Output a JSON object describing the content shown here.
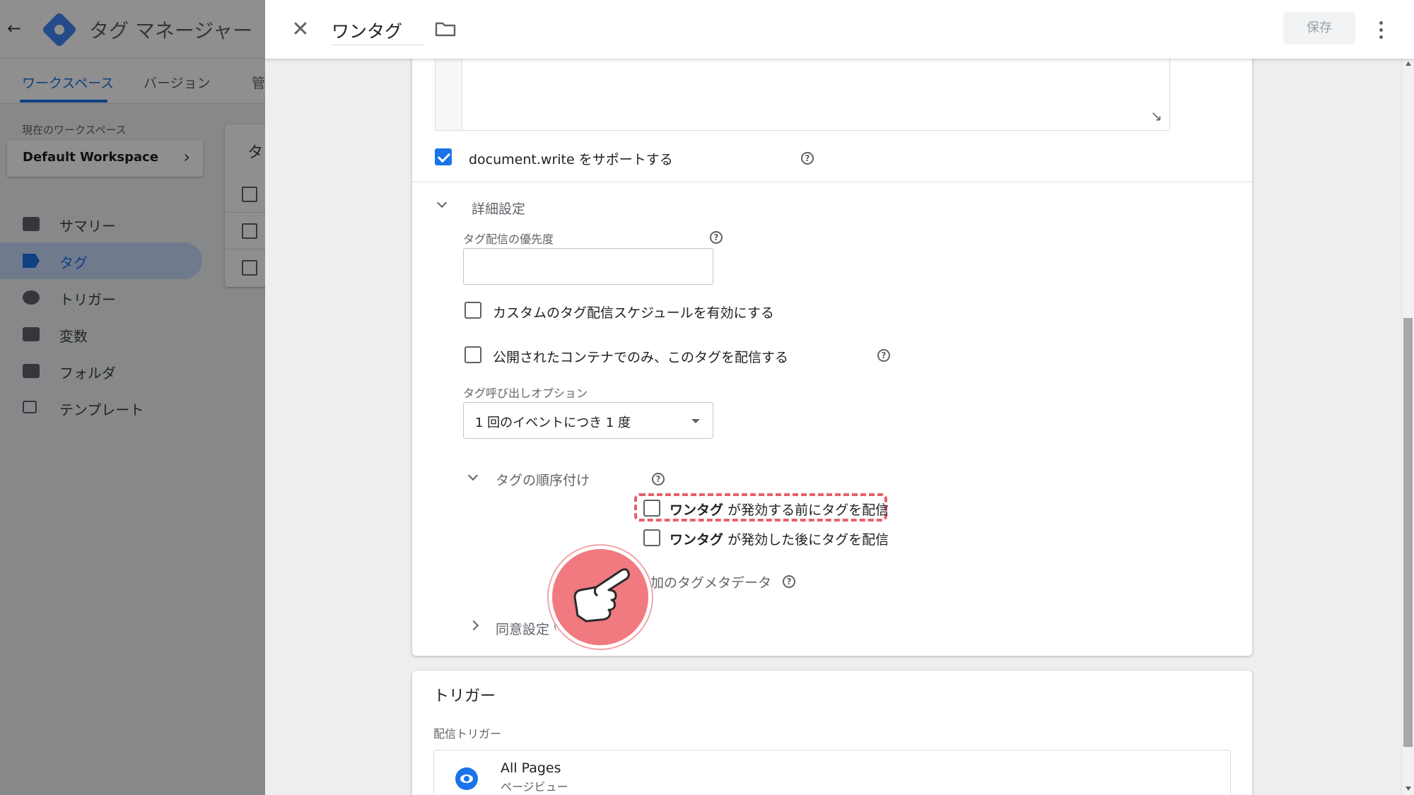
{
  "app": {
    "title": "タグ マネージャー",
    "tabs": [
      "ワークスペース",
      "バージョン",
      "管"
    ],
    "workspace_label": "現在のワークスペース",
    "workspace_name": "Default Workspace",
    "card_title": "タ",
    "nav": [
      {
        "label": "サマリー",
        "icon": "briefcase-icon"
      },
      {
        "label": "タグ",
        "icon": "tag-icon"
      },
      {
        "label": "トリガー",
        "icon": "trigger-icon"
      },
      {
        "label": "変数",
        "icon": "variables-icon"
      },
      {
        "label": "フォルダ",
        "icon": "folder-icon"
      },
      {
        "label": "テンプレート",
        "icon": "template-icon"
      }
    ]
  },
  "editor": {
    "tag_name": "ワンタグ",
    "save_label": "保存",
    "document_write_label": "document.write をサポートする",
    "document_write_checked": true,
    "advanced_settings_label": "詳細設定",
    "priority_label": "タグ配信の優先度",
    "priority_value": "",
    "custom_schedule_label": "カスタムのタグ配信スケジュールを有効にする",
    "publish_only_label": "公開されたコンテナでのみ、このタグを配信する",
    "firing_option_label": "タグ呼び出しオプション",
    "firing_option_value": "1 回のイベントにつき 1 度",
    "sequencing": {
      "label": "タグの順序付け",
      "before_tag": "ワンタグ",
      "before_text": "が発効する前にタグを配信",
      "after_tag": "ワンタグ",
      "after_text": "が発効した後にタグを配信"
    },
    "metadata_label": "追加のタグメタデータ",
    "consent_label": "同意設定",
    "consent_badge": "(BETA)"
  },
  "triggers": {
    "title": "トリガー",
    "subtitle": "配信トリガー",
    "items": [
      {
        "name": "All Pages",
        "type": "ページビュー"
      }
    ]
  },
  "colors": {
    "accent": "#1a73e8",
    "highlight": "#e8606a",
    "pointer": "#f07a80"
  }
}
